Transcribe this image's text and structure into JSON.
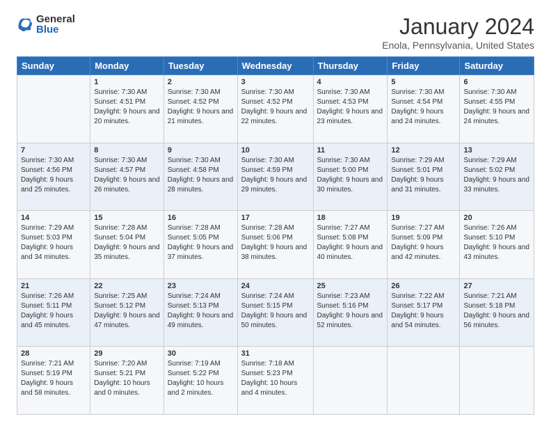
{
  "logo": {
    "general": "General",
    "blue": "Blue"
  },
  "title": "January 2024",
  "subtitle": "Enola, Pennsylvania, United States",
  "headers": [
    "Sunday",
    "Monday",
    "Tuesday",
    "Wednesday",
    "Thursday",
    "Friday",
    "Saturday"
  ],
  "weeks": [
    [
      {
        "day": "",
        "sunrise": "",
        "sunset": "",
        "daylight": ""
      },
      {
        "day": "1",
        "sunrise": "Sunrise: 7:30 AM",
        "sunset": "Sunset: 4:51 PM",
        "daylight": "Daylight: 9 hours and 20 minutes."
      },
      {
        "day": "2",
        "sunrise": "Sunrise: 7:30 AM",
        "sunset": "Sunset: 4:52 PM",
        "daylight": "Daylight: 9 hours and 21 minutes."
      },
      {
        "day": "3",
        "sunrise": "Sunrise: 7:30 AM",
        "sunset": "Sunset: 4:52 PM",
        "daylight": "Daylight: 9 hours and 22 minutes."
      },
      {
        "day": "4",
        "sunrise": "Sunrise: 7:30 AM",
        "sunset": "Sunset: 4:53 PM",
        "daylight": "Daylight: 9 hours and 23 minutes."
      },
      {
        "day": "5",
        "sunrise": "Sunrise: 7:30 AM",
        "sunset": "Sunset: 4:54 PM",
        "daylight": "Daylight: 9 hours and 24 minutes."
      },
      {
        "day": "6",
        "sunrise": "Sunrise: 7:30 AM",
        "sunset": "Sunset: 4:55 PM",
        "daylight": "Daylight: 9 hours and 24 minutes."
      }
    ],
    [
      {
        "day": "7",
        "sunrise": "Sunrise: 7:30 AM",
        "sunset": "Sunset: 4:56 PM",
        "daylight": "Daylight: 9 hours and 25 minutes."
      },
      {
        "day": "8",
        "sunrise": "Sunrise: 7:30 AM",
        "sunset": "Sunset: 4:57 PM",
        "daylight": "Daylight: 9 hours and 26 minutes."
      },
      {
        "day": "9",
        "sunrise": "Sunrise: 7:30 AM",
        "sunset": "Sunset: 4:58 PM",
        "daylight": "Daylight: 9 hours and 28 minutes."
      },
      {
        "day": "10",
        "sunrise": "Sunrise: 7:30 AM",
        "sunset": "Sunset: 4:59 PM",
        "daylight": "Daylight: 9 hours and 29 minutes."
      },
      {
        "day": "11",
        "sunrise": "Sunrise: 7:30 AM",
        "sunset": "Sunset: 5:00 PM",
        "daylight": "Daylight: 9 hours and 30 minutes."
      },
      {
        "day": "12",
        "sunrise": "Sunrise: 7:29 AM",
        "sunset": "Sunset: 5:01 PM",
        "daylight": "Daylight: 9 hours and 31 minutes."
      },
      {
        "day": "13",
        "sunrise": "Sunrise: 7:29 AM",
        "sunset": "Sunset: 5:02 PM",
        "daylight": "Daylight: 9 hours and 33 minutes."
      }
    ],
    [
      {
        "day": "14",
        "sunrise": "Sunrise: 7:29 AM",
        "sunset": "Sunset: 5:03 PM",
        "daylight": "Daylight: 9 hours and 34 minutes."
      },
      {
        "day": "15",
        "sunrise": "Sunrise: 7:28 AM",
        "sunset": "Sunset: 5:04 PM",
        "daylight": "Daylight: 9 hours and 35 minutes."
      },
      {
        "day": "16",
        "sunrise": "Sunrise: 7:28 AM",
        "sunset": "Sunset: 5:05 PM",
        "daylight": "Daylight: 9 hours and 37 minutes."
      },
      {
        "day": "17",
        "sunrise": "Sunrise: 7:28 AM",
        "sunset": "Sunset: 5:06 PM",
        "daylight": "Daylight: 9 hours and 38 minutes."
      },
      {
        "day": "18",
        "sunrise": "Sunrise: 7:27 AM",
        "sunset": "Sunset: 5:08 PM",
        "daylight": "Daylight: 9 hours and 40 minutes."
      },
      {
        "day": "19",
        "sunrise": "Sunrise: 7:27 AM",
        "sunset": "Sunset: 5:09 PM",
        "daylight": "Daylight: 9 hours and 42 minutes."
      },
      {
        "day": "20",
        "sunrise": "Sunrise: 7:26 AM",
        "sunset": "Sunset: 5:10 PM",
        "daylight": "Daylight: 9 hours and 43 minutes."
      }
    ],
    [
      {
        "day": "21",
        "sunrise": "Sunrise: 7:26 AM",
        "sunset": "Sunset: 5:11 PM",
        "daylight": "Daylight: 9 hours and 45 minutes."
      },
      {
        "day": "22",
        "sunrise": "Sunrise: 7:25 AM",
        "sunset": "Sunset: 5:12 PM",
        "daylight": "Daylight: 9 hours and 47 minutes."
      },
      {
        "day": "23",
        "sunrise": "Sunrise: 7:24 AM",
        "sunset": "Sunset: 5:13 PM",
        "daylight": "Daylight: 9 hours and 49 minutes."
      },
      {
        "day": "24",
        "sunrise": "Sunrise: 7:24 AM",
        "sunset": "Sunset: 5:15 PM",
        "daylight": "Daylight: 9 hours and 50 minutes."
      },
      {
        "day": "25",
        "sunrise": "Sunrise: 7:23 AM",
        "sunset": "Sunset: 5:16 PM",
        "daylight": "Daylight: 9 hours and 52 minutes."
      },
      {
        "day": "26",
        "sunrise": "Sunrise: 7:22 AM",
        "sunset": "Sunset: 5:17 PM",
        "daylight": "Daylight: 9 hours and 54 minutes."
      },
      {
        "day": "27",
        "sunrise": "Sunrise: 7:21 AM",
        "sunset": "Sunset: 5:18 PM",
        "daylight": "Daylight: 9 hours and 56 minutes."
      }
    ],
    [
      {
        "day": "28",
        "sunrise": "Sunrise: 7:21 AM",
        "sunset": "Sunset: 5:19 PM",
        "daylight": "Daylight: 9 hours and 58 minutes."
      },
      {
        "day": "29",
        "sunrise": "Sunrise: 7:20 AM",
        "sunset": "Sunset: 5:21 PM",
        "daylight": "Daylight: 10 hours and 0 minutes."
      },
      {
        "day": "30",
        "sunrise": "Sunrise: 7:19 AM",
        "sunset": "Sunset: 5:22 PM",
        "daylight": "Daylight: 10 hours and 2 minutes."
      },
      {
        "day": "31",
        "sunrise": "Sunrise: 7:18 AM",
        "sunset": "Sunset: 5:23 PM",
        "daylight": "Daylight: 10 hours and 4 minutes."
      },
      {
        "day": "",
        "sunrise": "",
        "sunset": "",
        "daylight": ""
      },
      {
        "day": "",
        "sunrise": "",
        "sunset": "",
        "daylight": ""
      },
      {
        "day": "",
        "sunrise": "",
        "sunset": "",
        "daylight": ""
      }
    ]
  ]
}
